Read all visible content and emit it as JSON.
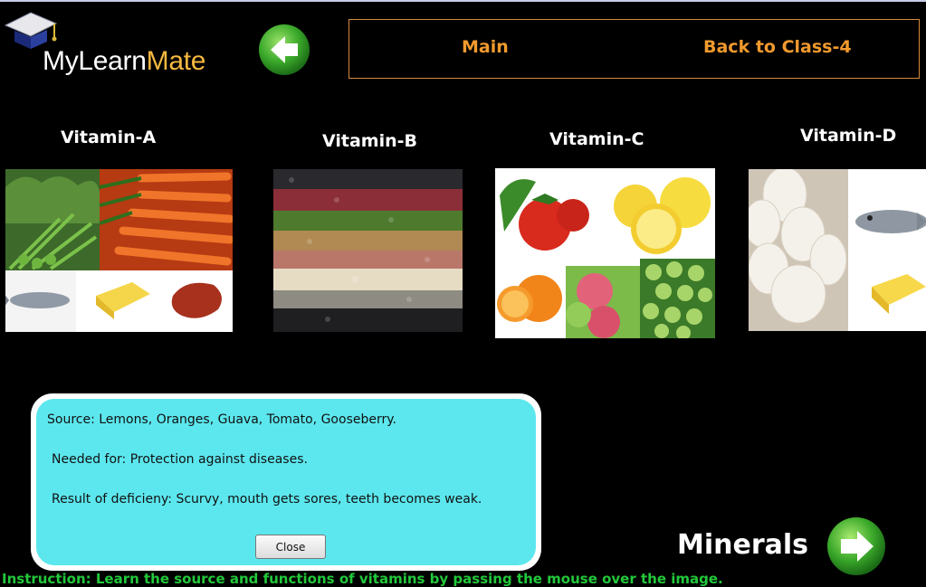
{
  "header": {
    "logo_my": "My",
    "logo_learn": "Learn",
    "logo_mate": "Mate",
    "back_icon": "back-arrow-icon",
    "nav": {
      "main": "Main",
      "back_to_class": "Back to Class-4"
    }
  },
  "vitamins": [
    {
      "title": "Vitamin-A"
    },
    {
      "title": "Vitamin-B"
    },
    {
      "title": "Vitamin-C"
    },
    {
      "title": "Vitamin-D"
    }
  ],
  "popup": {
    "source": "Source: Lemons, Oranges, Guava, Tomato, Gooseberry.",
    "needed_for": "Needed for: Protection against diseases.",
    "deficiency": "Result of deficieny: Scurvy, mouth gets sores, teeth becomes weak.",
    "close_label": "Close"
  },
  "footer": {
    "next_label": "Minerals",
    "next_icon": "forward-arrow-icon",
    "instruction": "Instruction: Learn the source and functions of vitamins by passing the mouse over the image."
  },
  "colors": {
    "background": "#000000",
    "nav_text": "#f29a2e",
    "nav_border": "#d68a3c",
    "popup_bg": "#5ce7ee",
    "instruction": "#22c83a",
    "arrow_green": "#3aa82a"
  }
}
